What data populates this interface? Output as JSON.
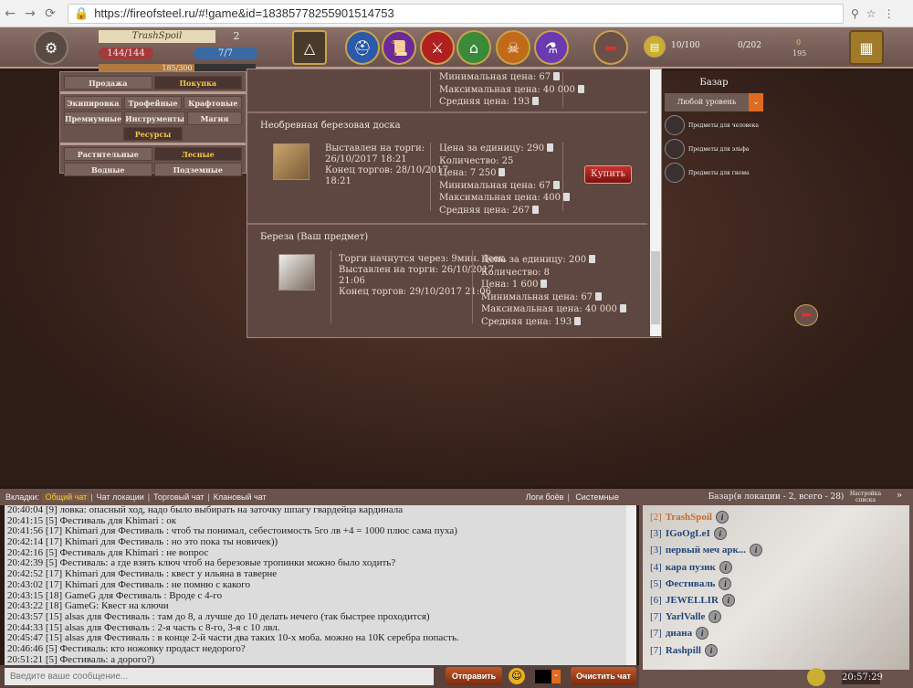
{
  "browser": {
    "url": "https://fireofsteel.ru/#!game&id=18385778255901514753"
  },
  "colors": {
    "accent": "#f2c94a",
    "hp": "#a33b3b",
    "mp": "#3b6aa3",
    "player_self": "#c86a2a",
    "player": "#23467a"
  },
  "player": {
    "name": "TrashSpoil",
    "level": "2",
    "hp": "144/144",
    "mp": "7/7",
    "xp": "185/300",
    "xp_fraction": 0.617
  },
  "resources": {
    "bag": "10/100",
    "chest": "0/202",
    "gold": "0",
    "silver": "195"
  },
  "filters": {
    "mode": [
      {
        "label": "Продажа",
        "active": false
      },
      {
        "label": "Покупка",
        "active": true
      }
    ],
    "categories": [
      [
        "Экипировка",
        "Трофейные",
        "Крафтовые"
      ],
      [
        "Премиумные",
        "Инструменты",
        "Магия"
      ]
    ],
    "resources_label": "Ресурсы",
    "sub": [
      [
        {
          "label": "Растительные",
          "active": false
        },
        {
          "label": "Лесные",
          "active": true
        }
      ],
      [
        {
          "label": "Водные",
          "active": false
        },
        {
          "label": "Подземные",
          "active": false
        }
      ]
    ]
  },
  "lots": [
    {
      "partial": true,
      "prices": [
        "Минимальная цена: 67",
        "Максимальная цена: 40 000",
        "Средняя цена: 193"
      ]
    },
    {
      "title": "Необревная березовая доска",
      "info": [
        "Выставлен на торги:",
        "26/10/2017 18:21",
        "Конец торгов: 28/10/2017",
        "18:21"
      ],
      "prices": [
        "Цена за единицу: 290",
        "Количество: 25",
        "Цена: 7 250",
        "Минимальная цена: 67",
        "Максимальная цена: 400",
        "Средняя цена: 267"
      ],
      "buy": "Купить"
    },
    {
      "title": "Береза (Ваш предмет)",
      "info": [
        "Торги начнутся через: 9мин. 4сек.",
        "Выставлен на торги: 26/10/2017",
        "21:06",
        "Конец торгов: 29/10/2017 21:06"
      ],
      "prices": [
        "Цена за единицу: 200",
        "Количество: 8",
        "Цена: 1 600",
        "Минимальная цена: 67",
        "Максимальная цена: 40 000",
        "Средняя цена: 193"
      ]
    }
  ],
  "sidebar": {
    "title": "Базар",
    "level_select": "Любой уровень",
    "races": [
      "Предметы для человека",
      "Предметы для эльфа",
      "Предметы для гнома"
    ]
  },
  "chat": {
    "tabs_label": "Вкладки:",
    "tabs": [
      "Общий чат",
      "Чат локации",
      "Торговый чат",
      "Клановый чат"
    ],
    "right_tabs": [
      "Логи боёв",
      "Системные"
    ],
    "messages": [
      "20:40:04 [9] ловка: опасный ход, надо было выбирать на заточку шпагу гвардейца кардинала",
      "20:41:15 [5] Фестиваль для Khimari : ок",
      "20:41:56 [17] Khimari для Фестиваль : чтоб ты понимал, себестоимость 5го лв +4 = 1000 плюс сама пуха)",
      "20:42:14 [17] Khimari для Фестиваль : но это пока ты новичек))",
      "20:42:16 [5] Фестиваль для Khimari : не вопрос",
      "20:42:39 [5] Фестиваль: а где взять ключ чтоб на березовые тропинки можно было ходить?",
      "20:42:52 [17] Khimari для Фестиваль : квест у ильяна в таверне",
      "20:43:02 [17] Khimari для Фестиваль : не помню с какого",
      "20:43:15 [18] GameG для Фестиваль : Вроде с 4-го",
      "20:43:22 [18] GameG: Квест на ключи",
      "20:43:57 [15] alsas для Фестиваль : там до 8, а лучше до 10 делать нечего (так быстрее проходится)",
      "20:44:33 [15] alsas для Фестиваль : 2-я часть с 8-го, 3-я с 10 лвл.",
      "20:45:47 [15] alsas для Фестиваль : в конце 2-й части два таких 10-х моба. можно на 10К серебра попасть.",
      "20:46:46 [5] Фестиваль: кто ножовку продаст недорого?",
      "20:51:21 [5] Фестиваль: а дорого?)"
    ],
    "input_placeholder": "Введите ваше сообщение...",
    "send": "Отправить",
    "clear": "Очистить чат"
  },
  "players": {
    "header": "Базар(в локации - 2, всего - 28)",
    "settings": "Настройка списка",
    "list": [
      {
        "lv": "[2]",
        "name": "TrashSpoil",
        "me": true
      },
      {
        "lv": "[3]",
        "name": "IGoOgLeI"
      },
      {
        "lv": "[3]",
        "name": "первый меч арк..."
      },
      {
        "lv": "[4]",
        "name": "кара пузик"
      },
      {
        "lv": "[5]",
        "name": "Фестиваль"
      },
      {
        "lv": "[6]",
        "name": "JEWELLIR"
      },
      {
        "lv": "[7]",
        "name": "YarlValle"
      },
      {
        "lv": "[7]",
        "name": "диана"
      },
      {
        "lv": "[7]",
        "name": "Rashpill"
      }
    ]
  },
  "clock": "20:57:29"
}
